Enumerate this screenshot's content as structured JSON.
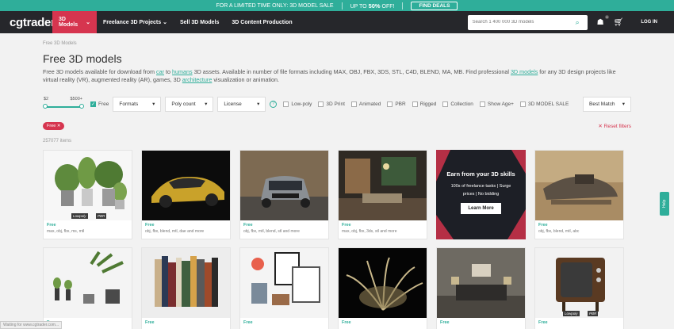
{
  "promo": {
    "text": "FOR A LIMITED TIME ONLY: 3D MODEL SALE",
    "up_to": "UP TO",
    "percent": "50%",
    "off": "OFF!",
    "button": "FIND DEALS"
  },
  "nav": {
    "logo": "cgtrader",
    "items": [
      "3D Models",
      "Freelance 3D Projects",
      "Sell 3D Models",
      "3D Content Production"
    ],
    "search_placeholder": "Search 1 400 000 3D models",
    "cart_badge": "0",
    "login": "LOG IN"
  },
  "breadcrumb": "Free 3D Models",
  "title": "Free 3D models",
  "desc": {
    "p1": "Free 3D models available for download from ",
    "car": "car",
    "to": " to ",
    "humans": "humans",
    "p2": " 3D assets. Available in number of file formats including MAX, OBJ, FBX, 3DS, STL, C4D, BLEND, MA, MB. Find professional ",
    "models": "3D models",
    "p3": " for any 3D design projects like virtual reality (VR), augmented reality (AR), games, 3D ",
    "arch": "architecture",
    "p4": " visualization or animation."
  },
  "filters": {
    "price_min": "$2",
    "price_max": "$500+",
    "free": "Free",
    "dropdowns": [
      "Formats",
      "Poly count",
      "License"
    ],
    "checkboxes": [
      "Low-poly",
      "3D Print",
      "Animated",
      "PBR",
      "Rigged",
      "Collection",
      "Show Age+",
      "3D MODEL SALE"
    ],
    "sort": "Best Match"
  },
  "chip": "Free ✕",
  "reset": "✕ Reset filters",
  "count": "257077 items",
  "cards": [
    {
      "free": "Free",
      "formats": "max, obj, fbx, ms, mtl",
      "tags": [
        "Lowpoly",
        "PBR"
      ]
    },
    {
      "free": "Free",
      "formats": "obj, fbx, blend, mtl, dae and more",
      "tags": []
    },
    {
      "free": "Free",
      "formats": "obj, fbx, mtl, blend, stl and more",
      "tags": []
    },
    {
      "free": "Free",
      "formats": "max, obj, fbx, 3ds, stl and more",
      "tags": []
    },
    {
      "free": "Free",
      "formats": "obj, fbx, blend, mtl, abc",
      "tags": []
    }
  ],
  "ad": {
    "title": "Earn from your 3D skills",
    "sub1": "100s of freelance tasks | Surge",
    "sub2": "prices | No bidding",
    "button": "Learn More"
  },
  "row2": [
    {
      "free": "Free",
      "tags": []
    },
    {
      "free": "Free",
      "tags": []
    },
    {
      "free": "Free",
      "tags": []
    },
    {
      "free": "Free",
      "tags": []
    },
    {
      "free": "Free",
      "tags": []
    },
    {
      "free": "Free",
      "tags": [
        "Lowpoly",
        "PBR"
      ]
    }
  ],
  "help": "Help",
  "status": "Waiting for www.cgtrader.com..."
}
